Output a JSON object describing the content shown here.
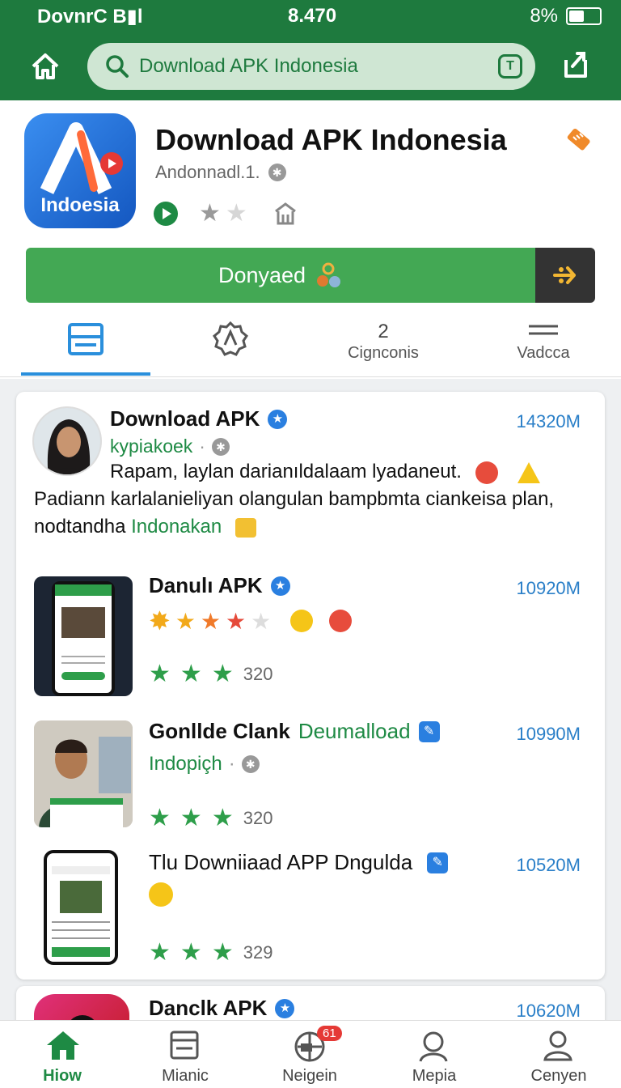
{
  "status_bar": {
    "carrier": "DovnrC B▮l",
    "time": "8.470",
    "battery": "8%"
  },
  "app_bar": {
    "search_text": "Download APK Indonesia"
  },
  "app": {
    "icon_label": "Indoesia",
    "title": "Download APK Indonesia",
    "developer": "Andonnadl.1.",
    "download_label": "Donyaed"
  },
  "tabs": [
    {
      "label": ""
    },
    {
      "label": ""
    },
    {
      "label": "Cignconis",
      "count": "2"
    },
    {
      "label": "Vadcca"
    }
  ],
  "featured": {
    "title": "Download APK",
    "subtitle": "kypiakoek",
    "size": "14320M",
    "desc_line1": "Rapam, laylan darianıldalaam lyadaneut.",
    "desc_line2": "Padiann karlalanieliyan olangulan bampbmta ciankeisa plan,",
    "desc_line3_prefix": "nodtandha ",
    "desc_line3_accent": "Indonakan"
  },
  "list": [
    {
      "title": "Danulı APK",
      "size": "10920M",
      "rating_count": "320"
    },
    {
      "title": "Gonllde Clank",
      "title_accent": "Deumalload",
      "subtitle": "Indopiçh",
      "size": "10990M",
      "rating_count": "320"
    },
    {
      "title": "Tlu Downiiaad APP Dngulda",
      "size": "10520M",
      "rating_count": "329"
    },
    {
      "title": "Danclk APK",
      "size": "10620M"
    }
  ],
  "bottom_nav": [
    {
      "label": "Hiow",
      "active": true
    },
    {
      "label": "Mianic"
    },
    {
      "label": "Neigein",
      "badge": "61"
    },
    {
      "label": "Mepia"
    },
    {
      "label": "Cenyen"
    }
  ],
  "colors": {
    "primary_green": "#1e7a3e",
    "button_green": "#43a854",
    "link_blue": "#2a7fc8"
  }
}
